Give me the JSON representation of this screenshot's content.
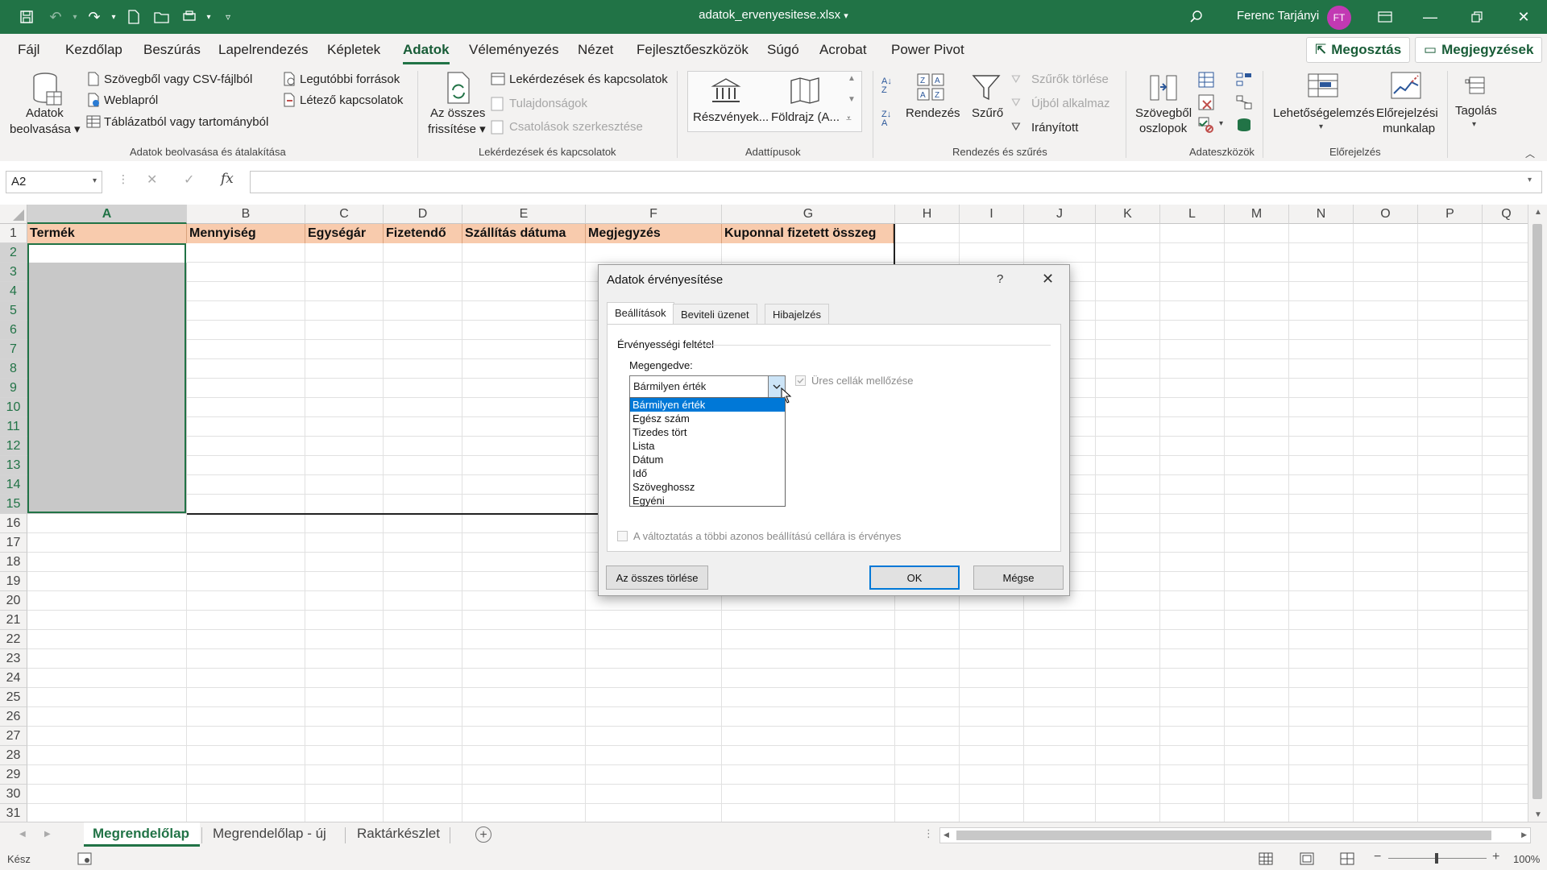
{
  "window": {
    "title": "adatok_ervenyesitese.xlsx",
    "user": "Ferenc Tarjányi",
    "user_initials": "FT"
  },
  "menu": {
    "tabs": [
      "Fájl",
      "Kezdőlap",
      "Beszúrás",
      "Lapelrendezés",
      "Képletek",
      "Adatok",
      "Véleményezés",
      "Nézet",
      "Fejlesztőeszközök",
      "Súgó",
      "Acrobat",
      "Power Pivot"
    ],
    "active": "Adatok",
    "share": "Megosztás",
    "comments": "Megjegyzések"
  },
  "ribbon": {
    "get_data": {
      "big_line1": "Adatok",
      "big_line2": "beolvasása",
      "from_text": "Szövegből vagy CSV-fájlból",
      "from_web": "Weblapról",
      "from_table": "Táblázatból vagy tartományból",
      "recent": "Legutóbbi források",
      "existing": "Létező kapcsolatok",
      "group": "Adatok beolvasása és átalakítása"
    },
    "queries": {
      "refresh_line1": "Az összes",
      "refresh_line2": "frissítése",
      "queries_connections": "Lekérdezések és kapcsolatok",
      "properties": "Tulajdonságok",
      "edit_links": "Csatolások szerkesztése",
      "group": "Lekérdezések és kapcsolatok"
    },
    "datatypes": {
      "stocks": "Részvények...",
      "geography": "Földrajz (A...",
      "group": "Adattípusok"
    },
    "sort": {
      "sort": "Rendezés",
      "filter": "Szűrő",
      "clear": "Szűrők törlése",
      "reapply": "Újból alkalmaz",
      "advanced": "Irányított",
      "group": "Rendezés és szűrés"
    },
    "tools": {
      "text_to_cols_line1": "Szövegből",
      "text_to_cols_line2": "oszlopok",
      "group": "Adateszközök"
    },
    "forecast": {
      "whatif": "Lehetőségelemzés",
      "sheet_line1": "Előrejelzési",
      "sheet_line2": "munkalap",
      "group": "Előrejelzés"
    },
    "outline": {
      "label": "Tagolás"
    }
  },
  "formula_bar": {
    "name_box": "A2",
    "fx": "fx",
    "content": ""
  },
  "sheet": {
    "columns": [
      "A",
      "B",
      "C",
      "D",
      "E",
      "F",
      "G",
      "H",
      "I",
      "J",
      "K",
      "L",
      "M",
      "N",
      "O",
      "P",
      "Q"
    ],
    "rows": [
      "1",
      "2",
      "3",
      "4",
      "5",
      "6",
      "7",
      "8",
      "9",
      "10",
      "11",
      "12",
      "13",
      "14",
      "15",
      "16",
      "17",
      "18",
      "19",
      "20",
      "21",
      "22",
      "23",
      "24",
      "25",
      "26",
      "27",
      "28",
      "29",
      "30",
      "31"
    ],
    "headers": [
      "Termék",
      "Mennyiség",
      "Egységár",
      "Fizetendő",
      "Szállítás dátuma",
      "Megjegyzés",
      "Kuponnal fizetett összeg"
    ],
    "header_color": "#f8cbad"
  },
  "sheet_tabs": [
    "Megrendelőlap",
    "Megrendelőlap - új",
    "Raktárkészlet"
  ],
  "active_sheet": "Megrendelőlap",
  "status": {
    "ready": "Kész",
    "zoom": "100%"
  },
  "dialog": {
    "title": "Adatok érvényesítése",
    "help": "?",
    "tabs": [
      "Beállítások",
      "Beviteli üzenet",
      "Hibajelzés"
    ],
    "active_tab": "Beállítások",
    "section": "Érvényességi feltétel",
    "allow_label": "Megengedve:",
    "allow_value": "Bármilyen érték",
    "options": [
      "Bármilyen érték",
      "Egész szám",
      "Tizedes tört",
      "Lista",
      "Dátum",
      "Idő",
      "Szöveghossz",
      "Egyéni"
    ],
    "ignore_blank": "Üres cellák mellőzése",
    "apply_all": "A változtatás a többi azonos beállítású cellára is érvényes",
    "clear_all": "Az összes törlése",
    "ok": "OK",
    "cancel": "Mégse"
  }
}
